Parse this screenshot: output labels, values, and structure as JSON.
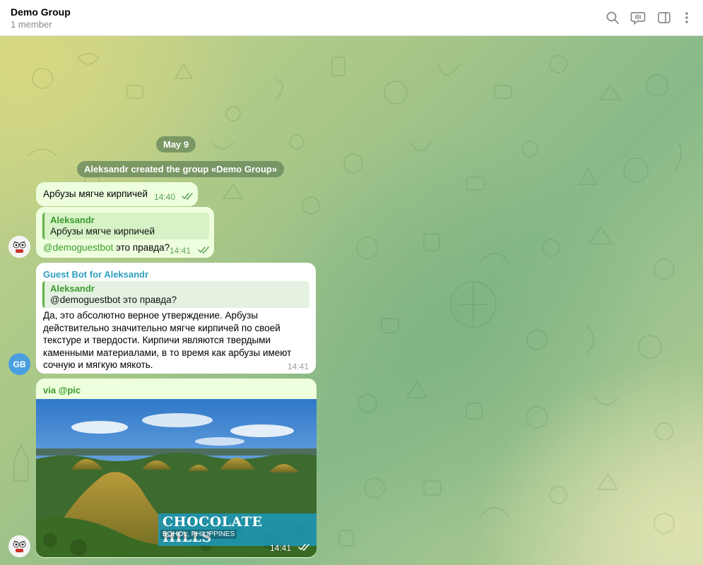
{
  "header": {
    "title": "Demo Group",
    "subtitle": "1 member",
    "icons": [
      "search-icon",
      "voice-chat-icon",
      "sidebar-toggle-icon",
      "more-icon"
    ]
  },
  "chat": {
    "date_pill": "May 9",
    "service_message": "Aleksandr created the group «Demo Group»",
    "messages": [
      {
        "text": "Арбузы мягче кирпичей",
        "time": "14:40"
      },
      {
        "reply_name": "Aleksandr",
        "reply_text": "Арбузы мягче кирпичей",
        "mention": "@demoguestbot",
        "text": " это правда?",
        "time": "14:41"
      },
      {
        "sender": "Guest Bot",
        "for_text": " for Aleksandr",
        "reply_name": "Aleksandr",
        "reply_text": "@demoguestbot это правда?",
        "text": "Да, это абсолютно верное утверждение. Арбузы действительно значительно мягче кирпичей по своей текстуре и твердости. Кирпичи являются твердыми каменными материалами, в то время как арбузы имеют сочную и мягкую мякоть.",
        "time": "14:41",
        "avatar_initials": "GB"
      },
      {
        "via": "via @pic",
        "caption_title": "CHOCOLATE HILLS",
        "caption_subtitle": "BOHOL, PHILIPPINES",
        "time": "14:41"
      }
    ]
  },
  "colors": {
    "outgoing_bubble": "#eeffde",
    "incoming_bubble": "#ffffff",
    "accent_green": "#3a9a2c",
    "bot_name": "#2e9fbf",
    "avatar_gb": "#4a9fe0"
  }
}
